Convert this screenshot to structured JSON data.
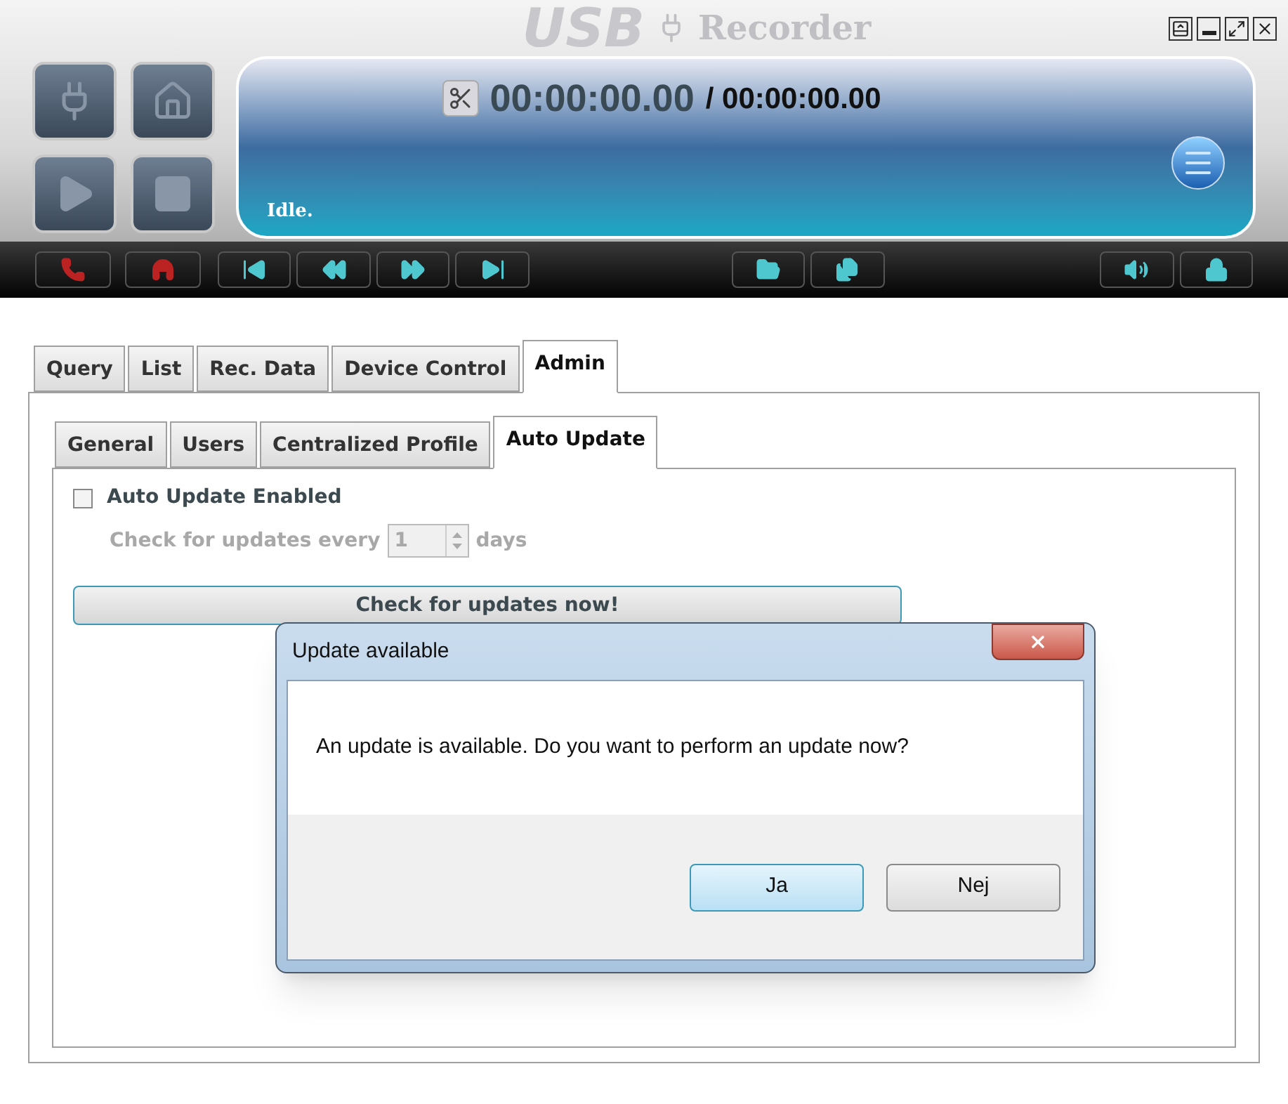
{
  "window": {
    "logo": "USB",
    "title": "Recorder"
  },
  "player": {
    "elapsed": "00:00:00.00",
    "total": "/ 00:00:00.00",
    "status": "Idle."
  },
  "tabs": [
    {
      "label": "Query",
      "selected": false
    },
    {
      "label": "List",
      "selected": false
    },
    {
      "label": "Rec. Data",
      "selected": false
    },
    {
      "label": "Device Control",
      "selected": false
    },
    {
      "label": "Admin",
      "selected": true
    }
  ],
  "subtabs": [
    {
      "label": "General",
      "selected": false
    },
    {
      "label": "Users",
      "selected": false
    },
    {
      "label": "Centralized Profile",
      "selected": false
    },
    {
      "label": "Auto Update",
      "selected": true
    }
  ],
  "auto_update": {
    "enabled_label": "Auto Update Enabled",
    "checked": false,
    "interval_label": "Check for updates every",
    "interval_value": "1",
    "interval_unit": "days",
    "disabled": true,
    "check_button": "Check for updates now!"
  },
  "dialog": {
    "title": "Update available",
    "message": "An update is available. Do you want to perform an update now?",
    "buttons": [
      {
        "label": "Ja",
        "default": true
      },
      {
        "label": "Nej",
        "default": false
      }
    ]
  }
}
